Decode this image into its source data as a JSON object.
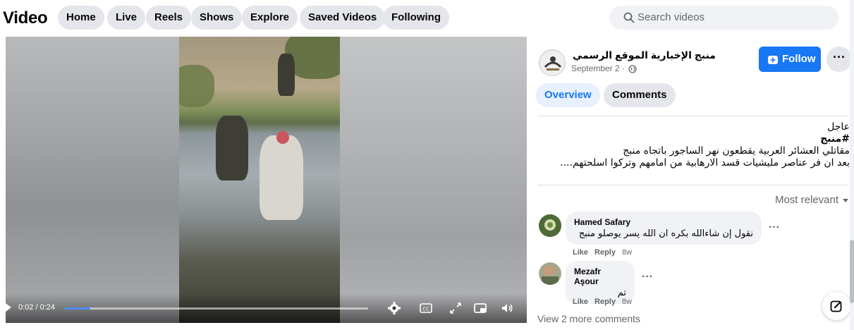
{
  "header": {
    "brand": "Video",
    "nav": [
      "Home",
      "Live",
      "Reels",
      "Shows",
      "Explore",
      "Saved Videos",
      "Following"
    ],
    "search_placeholder": "Search videos"
  },
  "player": {
    "time": "0:02 / 0:24",
    "progress_fraction": 0.083
  },
  "post": {
    "page_name": "منبج الإخبارية الموقع الرسمي",
    "date": "September 2 ·",
    "follow_label": "Follow",
    "more_label": "···",
    "tabs": [
      "Overview",
      "Comments"
    ],
    "text_lines": [
      "عاجل",
      "#منبج",
      "مقاتلي العشائر العربية يقطعون نهر الساجور باتجاه منبج",
      "بعد ان فر عناصر مليشيات قسد الارهابية من امامهم وتركوا اسلحتهم...."
    ]
  },
  "comments_section": {
    "sort_label": "Most relevant",
    "comments": [
      {
        "author": "Hamed Safary",
        "text": "نقول إن شاءالله بكره ان الله يسر يوصلو منبج",
        "like": "Like",
        "reply": "Reply",
        "age": "8w"
      },
      {
        "author": "Mezafr Aşour",
        "text": "تم",
        "like": "Like",
        "reply": "Reply",
        "age": "8w"
      }
    ],
    "view_more": "View 2 more comments",
    "dots": "···"
  },
  "colors": {
    "accent": "#1877f2",
    "pill_bg": "#e4e6eb",
    "muted_text": "#65676b"
  }
}
